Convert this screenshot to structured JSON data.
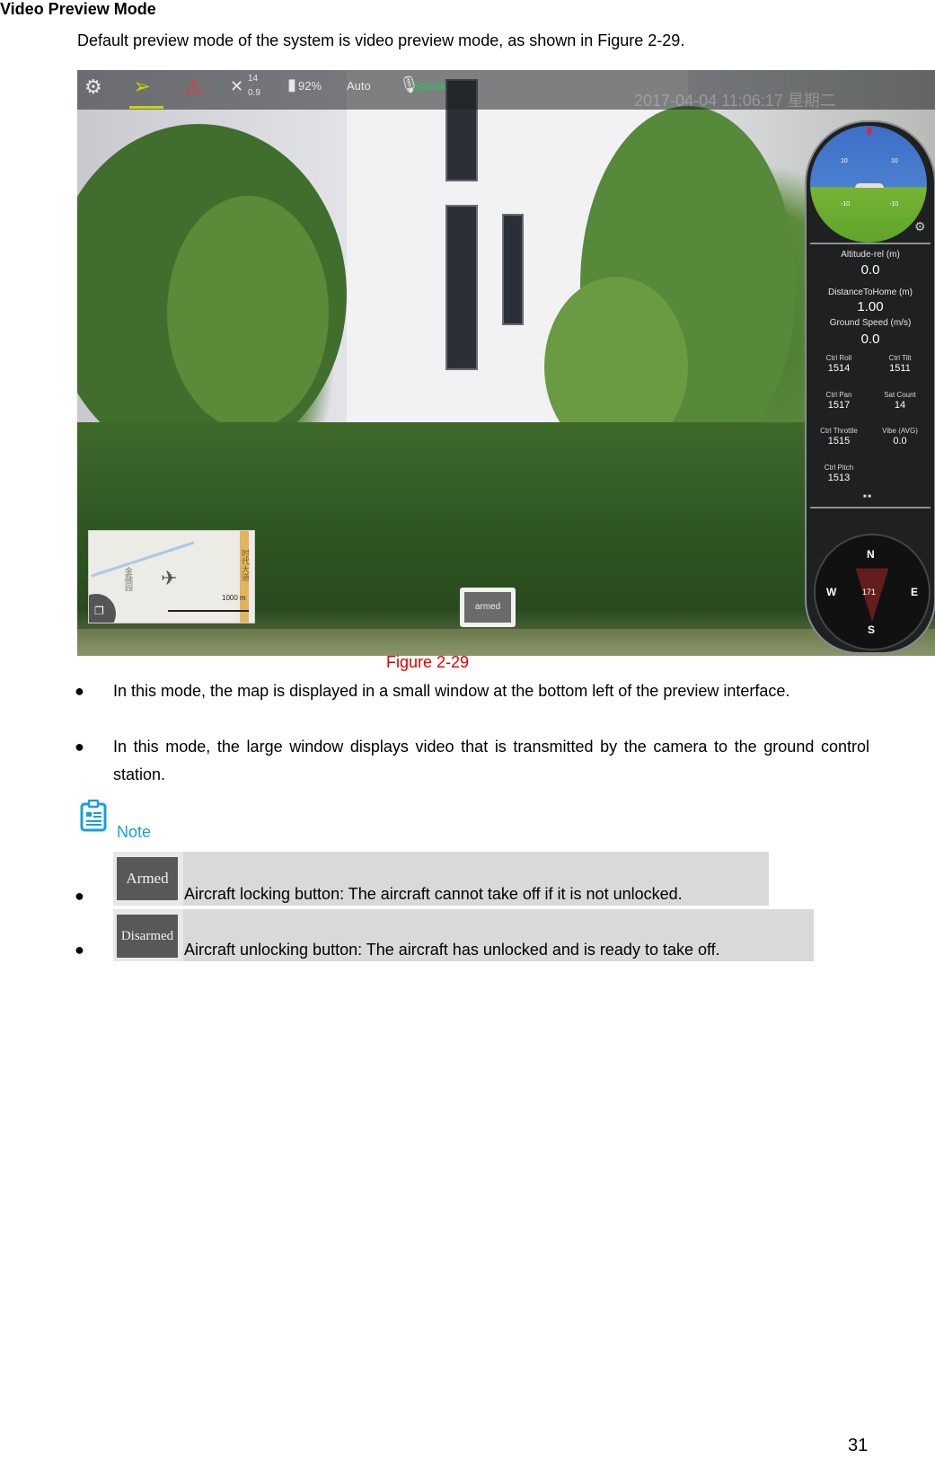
{
  "section_title": "Video Preview Mode",
  "intro": "Default preview mode of the system is video preview mode, as shown in Figure 2-29.",
  "figure": {
    "top_bar": {
      "icons": [
        "settings-gears-icon",
        "flight-mode-paper-plane-icon",
        "warning-triangle-icon",
        "satellite-icon",
        "battery-icon",
        "microphone-icon"
      ],
      "satellite_count": "14",
      "hdop": "0.9",
      "battery": "92%",
      "mode": "Auto",
      "speak": "Speak",
      "datetime": "2017-04-04 11:06:17 星期二"
    },
    "telemetry": {
      "altitude_label": "Altitude-rel (m)",
      "altitude_value": "0.0",
      "distance_label": "DistanceToHome (m)",
      "distance_value": "1.00",
      "ground_speed_label": "Ground Speed (m/s)",
      "ground_speed_value": "0.0",
      "cells": [
        {
          "label": "Ctrl Roll",
          "value": "1514"
        },
        {
          "label": "Ctrl Tilt",
          "value": "1511"
        },
        {
          "label": "Ctrl Pan",
          "value": "1517"
        },
        {
          "label": "Sat Count",
          "value": "14"
        },
        {
          "label": "Ctrl Throttle",
          "value": "1515"
        },
        {
          "label": "Vibe (AVG)",
          "value": "0.0"
        },
        {
          "label": "Ctrl Pitch",
          "value": "1513"
        }
      ],
      "attitude_scale": [
        "10",
        "10",
        "-10",
        "-10"
      ]
    },
    "compass": {
      "n": "N",
      "s": "S",
      "e": "E",
      "w": "W",
      "heading": "171"
    },
    "minimap": {
      "scale": "1000 m",
      "road_label": "时代大道",
      "area_label": "金融园"
    },
    "armed_button": "armed"
  },
  "caption": "Figure 2-29",
  "bullets": [
    "In this mode, the map is displayed in a small window at the bottom left of the preview interface.",
    "In this mode, the large window displays video that is transmitted by the camera to the ground control station."
  ],
  "note": {
    "label": "Note",
    "items": [
      {
        "button": "Armed",
        "text": "Aircraft locking button: The aircraft cannot take off if it is not unlocked."
      },
      {
        "button": "Disarmed",
        "text": "Aircraft unlocking button: The aircraft has unlocked and is ready to take off."
      }
    ]
  },
  "page_number": "31"
}
